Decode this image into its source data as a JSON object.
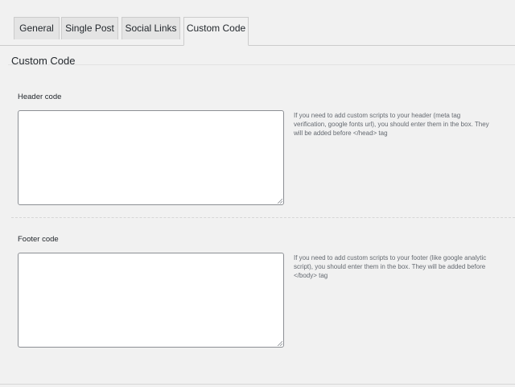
{
  "tabs": [
    {
      "label": "General",
      "active": false
    },
    {
      "label": "Single Post",
      "active": false
    },
    {
      "label": "Social Links",
      "active": false
    },
    {
      "label": "Custom Code",
      "active": true
    }
  ],
  "section": {
    "title": "Custom Code"
  },
  "header_code": {
    "label": "Header code",
    "value": "",
    "help": "If you need to add custom scripts to your header (meta tag verification, google fonts url), you should enter them in the box. They will be added before </head> tag"
  },
  "footer_code": {
    "label": "Footer code",
    "value": "",
    "help": "If you need to add custom scripts to your footer (like google analytic script), you should enter them in the box. They will be added before </body> tag"
  },
  "colors": {
    "background": "#f1f1f1",
    "tab_inactive": "#e4e4e4",
    "border": "#cccccc",
    "help_text": "#646970"
  }
}
